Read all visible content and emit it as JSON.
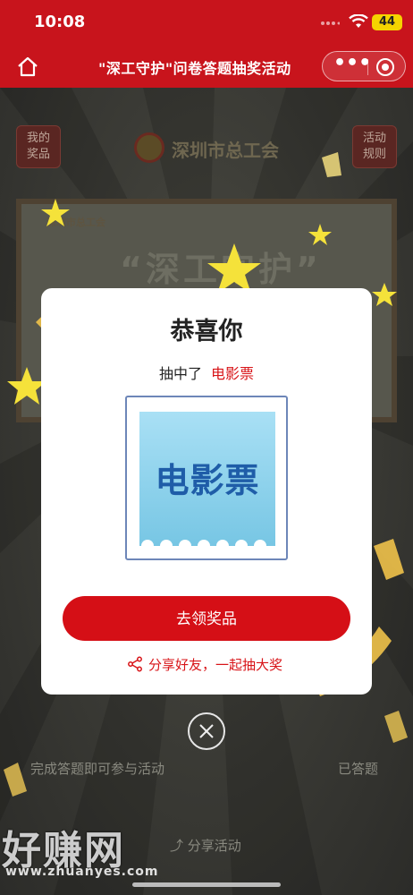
{
  "status_bar": {
    "time": "10:08",
    "battery": "44"
  },
  "navbar": {
    "title": "\"深工守护\"问卷答题抽奖活动"
  },
  "background_page": {
    "my_prizes": [
      "我的",
      "奖品"
    ],
    "rules": [
      "活动",
      "规则"
    ],
    "org_name": "深圳市总工会",
    "card_small_logo": "深圳市总工会",
    "card_title": "“深工守护”",
    "bottom_left": "完成答题即可参与活动",
    "bottom_right": "已答题",
    "share_activity": "分享活动"
  },
  "modal": {
    "title": "恭喜你",
    "won_prefix": "抽中了",
    "prize_name": "电影票",
    "ticket_text": "电影票",
    "claim_button": "去领奖品",
    "share_text": "分享好友，一起抽大奖"
  },
  "watermark": {
    "main": "好赚网",
    "url": "www.zhuanyes.com"
  },
  "colors": {
    "brand_red": "#c8141c",
    "button_red": "#d50f16",
    "ticket_blue": "#1f5da8"
  }
}
